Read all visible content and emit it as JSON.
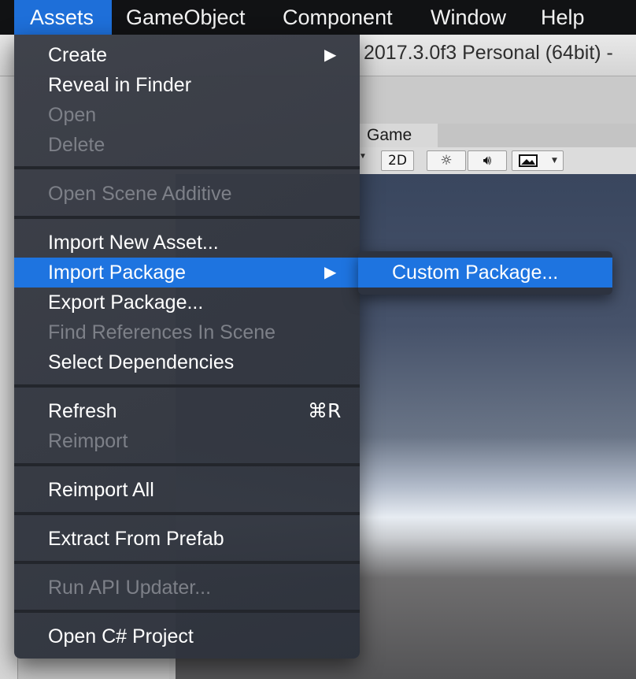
{
  "menubar": {
    "items": [
      "Assets",
      "GameObject",
      "Component",
      "Window",
      "Help"
    ],
    "active": "Assets"
  },
  "window": {
    "title": "2017.3.0f3 Personal (64bit) -"
  },
  "game_panel": {
    "tab_label": "Game",
    "mode_2d_label": "2D",
    "lighting_icon": "sun-icon",
    "audio_icon": "speaker-icon",
    "effects_icon": "image-icon",
    "dropdown_icon": "small-triangle-down-icon"
  },
  "assets_menu": {
    "items": [
      {
        "label": "Create",
        "enabled": true,
        "has_submenu": true
      },
      {
        "label": "Reveal in Finder",
        "enabled": true
      },
      {
        "label": "Open",
        "enabled": false
      },
      {
        "label": "Delete",
        "enabled": false
      },
      {
        "label": "Open Scene Additive",
        "enabled": false
      },
      {
        "label": "Import New Asset...",
        "enabled": true
      },
      {
        "label": "Import Package",
        "enabled": true,
        "has_submenu": true,
        "highlighted": true
      },
      {
        "label": "Export Package...",
        "enabled": true
      },
      {
        "label": "Find References In Scene",
        "enabled": false
      },
      {
        "label": "Select Dependencies",
        "enabled": true
      },
      {
        "label": "Refresh",
        "enabled": true,
        "shortcut": "⌘R"
      },
      {
        "label": "Reimport",
        "enabled": false
      },
      {
        "label": "Reimport All",
        "enabled": true
      },
      {
        "label": "Extract From Prefab",
        "enabled": true
      },
      {
        "label": "Run API Updater...",
        "enabled": false
      },
      {
        "label": "Open C# Project",
        "enabled": true
      }
    ],
    "submenu_arrow": "▶"
  },
  "import_package_submenu": {
    "items": [
      {
        "label": "Custom Package...",
        "highlighted": true
      }
    ]
  },
  "colors": {
    "highlight": "#1e74e0",
    "menubar_bg": "#111214",
    "menu_bg": "#3a3d46",
    "disabled_text": "#7d8088"
  }
}
